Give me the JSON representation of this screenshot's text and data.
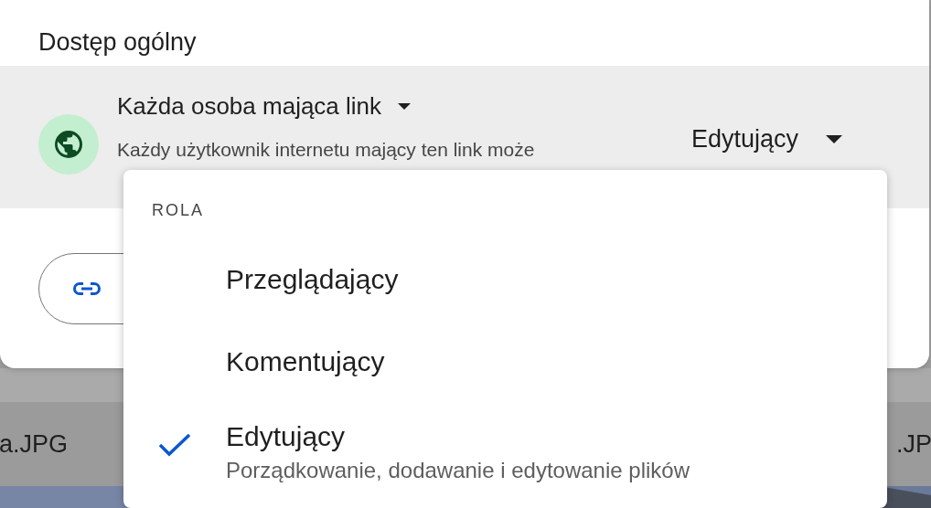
{
  "dialog": {
    "section_title": "Dostęp ogólny",
    "access": {
      "label": "Każda osoba mająca link",
      "description": "Każdy użytkownik internetu mający ten link może",
      "role": "Edytujący"
    },
    "copy_button": {
      "kind": "link"
    }
  },
  "background_files": [
    {
      "name": "a.JPG"
    },
    {
      "name": ".JP"
    }
  ],
  "role_menu": {
    "header": "ROLA",
    "items": [
      {
        "label": "Przeglądający",
        "selected": false
      },
      {
        "label": "Komentujący",
        "selected": false
      },
      {
        "label": "Edytujący",
        "description": "Porządkowanie, dodawanie i edytowanie plików",
        "selected": true
      }
    ]
  }
}
